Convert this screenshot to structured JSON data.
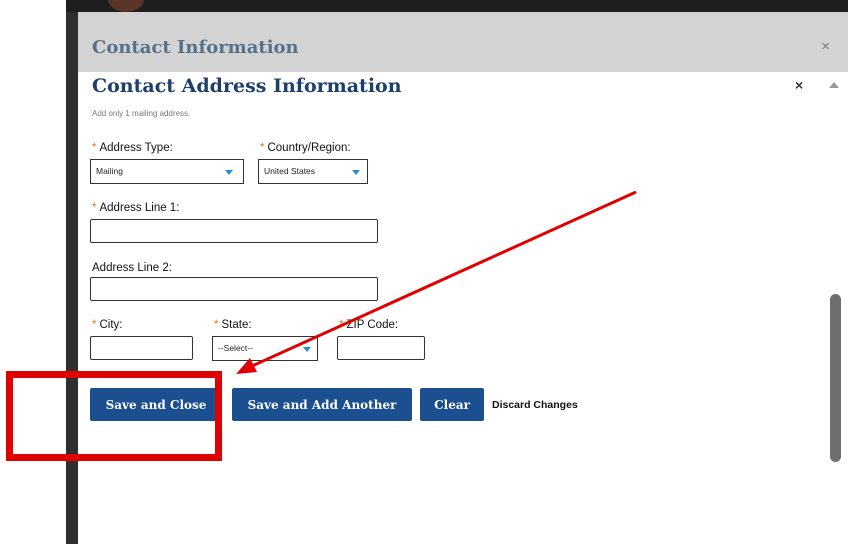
{
  "dialog": {
    "title": "Contact Information",
    "close_glyph": "×"
  },
  "section": {
    "title": "Contact Address Information",
    "close_glyph": "×",
    "hint": "Add only 1 mailing address."
  },
  "form": {
    "required_marker": "*",
    "address_type": {
      "label": "Address Type:",
      "value": "Mailing"
    },
    "country": {
      "label": "Country/Region:",
      "value": "United States"
    },
    "address_line_1": {
      "label": "Address Line 1:",
      "value": ""
    },
    "address_line_2": {
      "label": "Address Line 2:",
      "value": ""
    },
    "city": {
      "label": "City:",
      "value": ""
    },
    "state": {
      "label": "State:",
      "value": "--Select--"
    },
    "zip": {
      "label": "ZIP Code:",
      "value": ""
    }
  },
  "actions": {
    "save_close": "Save and Close",
    "save_add": "Save and Add Another",
    "clear": "Clear",
    "discard": "Discard Changes"
  },
  "colors": {
    "button": "#1b4f8f",
    "required": "#e07b1a",
    "annotation": "#e00000",
    "section_title": "#1d3f6a"
  },
  "icons": {
    "dropdown": "chevron-down-icon",
    "close": "close-icon",
    "scroll_up": "scroll-up-arrow-icon"
  }
}
